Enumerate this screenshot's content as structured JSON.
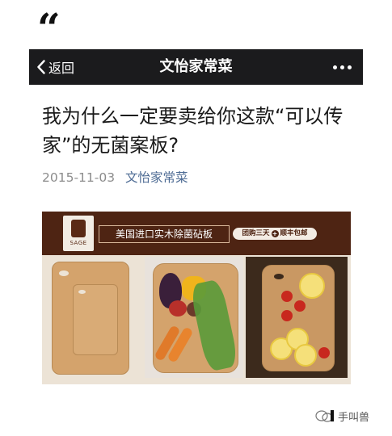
{
  "quote_mark": "“",
  "navbar": {
    "back_label": "返回",
    "title": "文怡家常菜"
  },
  "article": {
    "title": "我为什么一定要卖给你这款“可以传家”的无菌案板?",
    "date": "2015-11-03",
    "author": "文怡家常菜"
  },
  "banner": {
    "logo_text": "SAGE",
    "headline": "美国进口实木除菌砧板",
    "promo_left": "团购三天",
    "promo_plus": "+",
    "promo_right": "顺丰包邮"
  },
  "watermark": {
    "text": "手叫兽"
  },
  "colors": {
    "navbar_bg": "#1b1b1d",
    "author_link": "#4c6a93",
    "banner_brown": "#4e2413"
  },
  "icons": [
    "back-chevron-icon",
    "more-dots-icon",
    "wechat-watermark-icon"
  ]
}
